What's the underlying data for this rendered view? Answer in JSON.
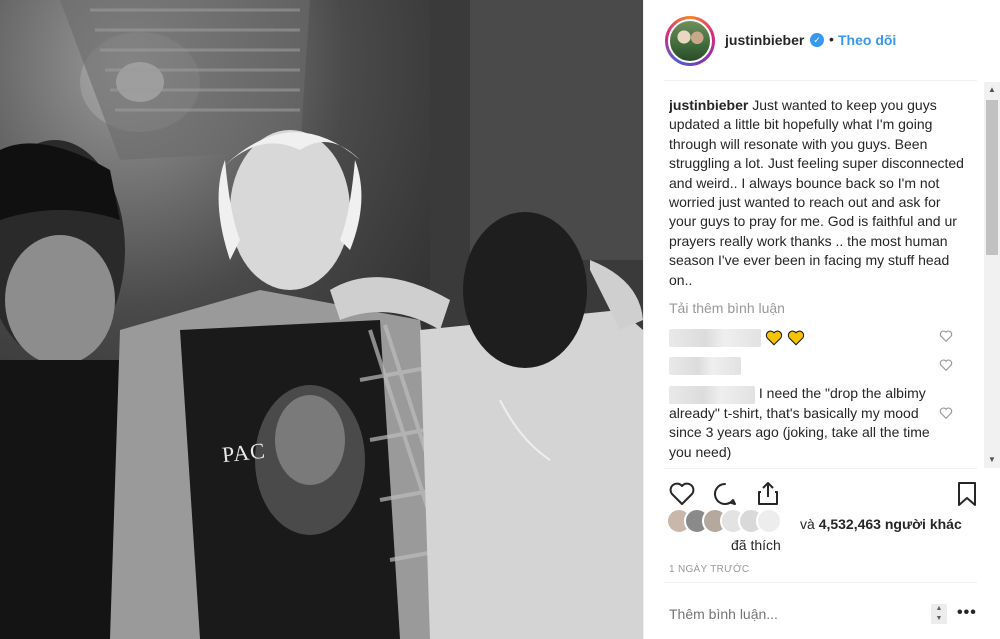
{
  "post": {
    "photo_alt": "Black and white photo of four men walking",
    "shirt_text": "PAC"
  },
  "header": {
    "username": "justinbieber",
    "verified_icon": "verified-badge-icon",
    "separator": "•",
    "follow_label": "Theo dõi"
  },
  "caption": {
    "username": "justinbieber",
    "text": "Just wanted to keep you guys updated a little bit hopefully what I'm going through will resonate with you guys. Been struggling a lot. Just feeling super disconnected and weird.. I always bounce back so I'm not worried just wanted to reach out and ask for your guys to pray for me. God is faithful and ur prayers really work thanks .. the most human season I've ever been in facing my stuff head on.."
  },
  "comments": {
    "load_more_label": "Tải thêm bình luận",
    "items": [
      {
        "text": ""
      },
      {
        "text": ""
      },
      {
        "text": "I need the \"drop the albimy already\" t-shirt, that's basically my mood since 3 years ago (joking, take all the time you need)"
      }
    ]
  },
  "likes": {
    "count_text": "4,532,463 người khác",
    "prefix": "và",
    "suffix": "đã thích"
  },
  "timestamp": "1 NGÀY TRƯỚC",
  "comment_box": {
    "placeholder": "Thêm bình luận..."
  },
  "more_label": "•••",
  "colors": {
    "accent": "#3897f0",
    "text": "#262626",
    "muted": "#999999",
    "heart_gold": "#f5c400"
  },
  "icons": [
    "heart-icon",
    "comment-icon",
    "share-icon",
    "bookmark-icon",
    "small-heart-icon",
    "verified-badge-icon"
  ]
}
